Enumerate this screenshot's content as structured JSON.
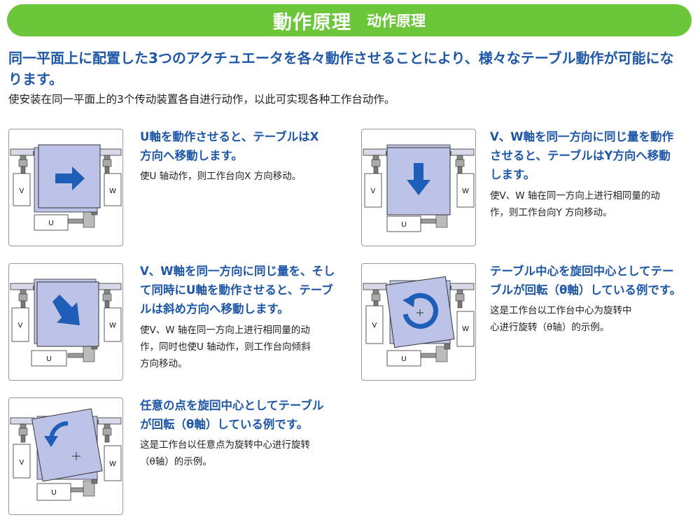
{
  "header": {
    "title_jp": "動作原理",
    "title_cn": "动作原理"
  },
  "intro": {
    "jp_line1": "同一平面上に配置した3つのアクチュエータを各々動作させることにより、様々なテーブル動作が可能にな",
    "jp_line2": "ります。",
    "cn": "使安装在同一平面上的3个传动装置各自进行动作，以此可实现各种工作台动作。"
  },
  "labels": {
    "u": "U",
    "v": "V",
    "w": "W"
  },
  "colors": {
    "banner": "#6cc63a",
    "accent": "#1e57a8",
    "table_fill": "#bcc3e6",
    "arrow": "#1f5eb8"
  },
  "cases": [
    {
      "icon": "arrow-right-icon",
      "jp": [
        "U軸を動作させると、テーブルはX",
        "方向へ移動します。"
      ],
      "cn": [
        "使U 轴动作，则工作台向X 方向移动。"
      ]
    },
    {
      "icon": "arrow-down-icon",
      "jp": [
        "V、W軸を同一方向に同じ量を動作",
        "させると、テーブルはY方向へ移動",
        "します。"
      ],
      "cn": [
        "使V、W 轴在同一方向上进行相同量的动",
        "作，则工作台向Y 方向移动。"
      ]
    },
    {
      "icon": "arrow-diagonal-icon",
      "jp": [
        "V、W軸を同一方向に同じ量を、そし",
        "て同時にU軸を動作させると、テーブ",
        "ルは斜め方向へ移動します。"
      ],
      "cn": [
        "使V、W 轴在同一方向上进行相同量的动",
        "作，同时也使U 轴动作，则工作台向倾斜",
        "方向移动。"
      ]
    },
    {
      "icon": "rotate-center-icon",
      "jp": [
        "テーブル中心を旋回中心としてテー",
        "ブルが回転（θ軸）している例です。"
      ],
      "cn": [
        "这是工作台以工作台中心为旋转中",
        "心进行旋转（θ轴）的示例。"
      ]
    },
    {
      "icon": "rotate-point-icon",
      "jp": [
        "任意の点を旋回中心としてテーブル",
        "が回転（θ軸）している例です。"
      ],
      "cn": [
        "这是工作台以任意点为旋转中心进行旋转",
        "（θ轴）的示例。"
      ]
    }
  ]
}
